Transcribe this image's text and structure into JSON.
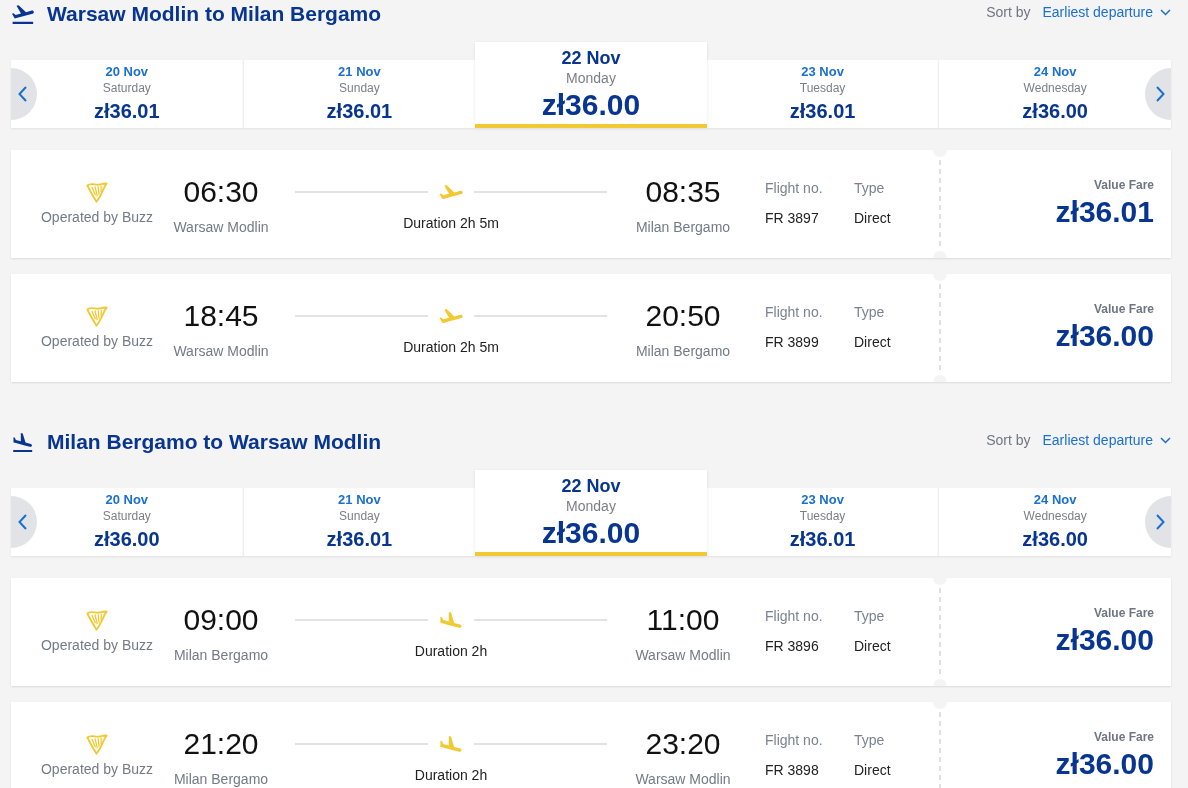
{
  "sections": [
    {
      "kind": "outbound",
      "title": "Warsaw Modlin to Milan Bergamo",
      "sort": {
        "label": "Sort by",
        "value": "Earliest departure"
      },
      "dates": [
        {
          "date": "20 Nov",
          "day": "Saturday",
          "price": "zł36.01",
          "selected": false
        },
        {
          "date": "21 Nov",
          "day": "Sunday",
          "price": "zł36.01",
          "selected": false
        },
        {
          "date": "22 Nov",
          "day": "Monday",
          "price": "zł36.00",
          "selected": true
        },
        {
          "date": "23 Nov",
          "day": "Tuesday",
          "price": "zł36.01",
          "selected": false
        },
        {
          "date": "24 Nov",
          "day": "Wednesday",
          "price": "zł36.00",
          "selected": false
        }
      ],
      "flights": [
        {
          "operator": "Operated by Buzz",
          "departure_time": "06:30",
          "departure_airport": "Warsaw Modlin",
          "duration": "Duration 2h 5m",
          "arrival_time": "08:35",
          "arrival_airport": "Milan Bergamo",
          "flight_no_label": "Flight no.",
          "flight_no": "FR 3897",
          "type_label": "Type",
          "type": "Direct",
          "fare_label": "Value Fare",
          "price": "zł36.01"
        },
        {
          "operator": "Operated by Buzz",
          "departure_time": "18:45",
          "departure_airport": "Warsaw Modlin",
          "duration": "Duration 2h 5m",
          "arrival_time": "20:50",
          "arrival_airport": "Milan Bergamo",
          "flight_no_label": "Flight no.",
          "flight_no": "FR 3899",
          "type_label": "Type",
          "type": "Direct",
          "fare_label": "Value Fare",
          "price": "zł36.00"
        }
      ]
    },
    {
      "kind": "inbound",
      "title": "Milan Bergamo to Warsaw Modlin",
      "sort": {
        "label": "Sort by",
        "value": "Earliest departure"
      },
      "dates": [
        {
          "date": "20 Nov",
          "day": "Saturday",
          "price": "zł36.00",
          "selected": false
        },
        {
          "date": "21 Nov",
          "day": "Sunday",
          "price": "zł36.01",
          "selected": false
        },
        {
          "date": "22 Nov",
          "day": "Monday",
          "price": "zł36.00",
          "selected": true
        },
        {
          "date": "23 Nov",
          "day": "Tuesday",
          "price": "zł36.01",
          "selected": false
        },
        {
          "date": "24 Nov",
          "day": "Wednesday",
          "price": "zł36.00",
          "selected": false
        }
      ],
      "flights": [
        {
          "operator": "Operated by Buzz",
          "departure_time": "09:00",
          "departure_airport": "Milan Bergamo",
          "duration": "Duration 2h",
          "arrival_time": "11:00",
          "arrival_airport": "Warsaw Modlin",
          "flight_no_label": "Flight no.",
          "flight_no": "FR 3896",
          "type_label": "Type",
          "type": "Direct",
          "fare_label": "Value Fare",
          "price": "zł36.00"
        },
        {
          "operator": "Operated by Buzz",
          "departure_time": "21:20",
          "departure_airport": "Milan Bergamo",
          "duration": "Duration 2h",
          "arrival_time": "23:20",
          "arrival_airport": "Warsaw Modlin",
          "flight_no_label": "Flight no.",
          "flight_no": "FR 3898",
          "type_label": "Type",
          "type": "Direct",
          "fare_label": "Value Fare",
          "price": "zł36.00"
        }
      ]
    }
  ]
}
